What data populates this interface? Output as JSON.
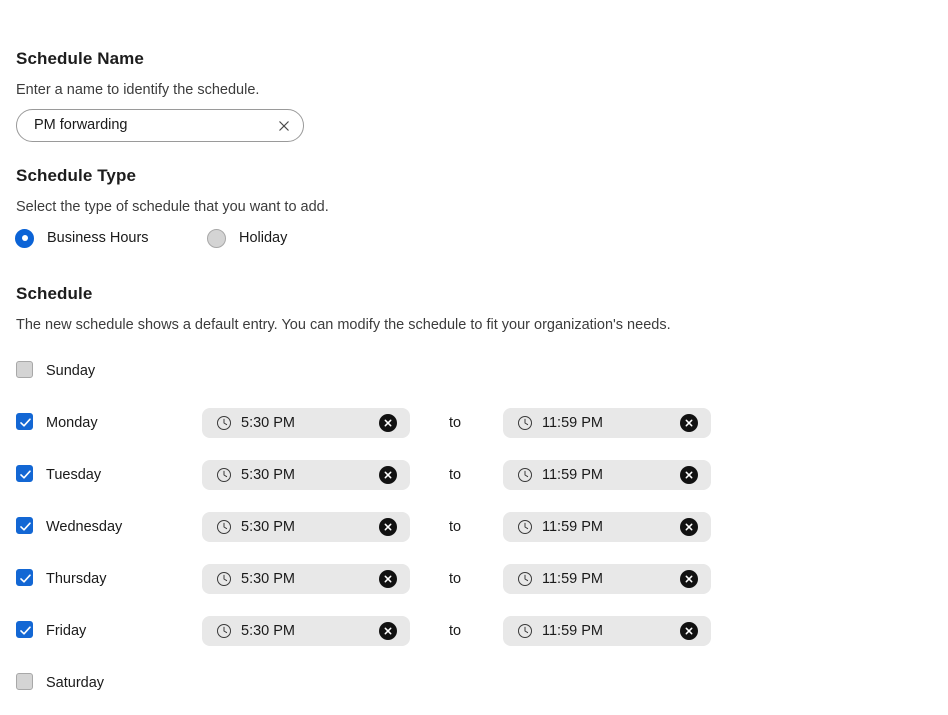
{
  "schedule_name": {
    "title": "Schedule Name",
    "description": "Enter a name to identify the schedule.",
    "value": "PM forwarding",
    "placeholder": "",
    "clear_icon": "close-icon"
  },
  "schedule_type": {
    "title": "Schedule Type",
    "description": "Select the type of schedule that you want to add.",
    "options": [
      {
        "label": "Business Hours",
        "selected": true
      },
      {
        "label": "Holiday",
        "selected": false
      }
    ]
  },
  "schedule": {
    "title": "Schedule",
    "description": "The new schedule shows a default entry. You can modify the schedule to fit your organization's needs.",
    "to_label": "to",
    "clock_icon": "clock-icon",
    "clear_icon": "close-circle-icon",
    "rows": [
      {
        "day": "Sunday",
        "checked": false,
        "has_times": false,
        "start": "",
        "end": ""
      },
      {
        "day": "Monday",
        "checked": true,
        "has_times": true,
        "start": "5:30 PM",
        "end": "11:59 PM"
      },
      {
        "day": "Tuesday",
        "checked": true,
        "has_times": true,
        "start": "5:30 PM",
        "end": "11:59 PM"
      },
      {
        "day": "Wednesday",
        "checked": true,
        "has_times": true,
        "start": "5:30 PM",
        "end": "11:59 PM"
      },
      {
        "day": "Thursday",
        "checked": true,
        "has_times": true,
        "start": "5:30 PM",
        "end": "11:59 PM"
      },
      {
        "day": "Friday",
        "checked": true,
        "has_times": true,
        "start": "5:30 PM",
        "end": "11:59 PM"
      },
      {
        "day": "Saturday",
        "checked": false,
        "has_times": false,
        "start": "",
        "end": ""
      }
    ]
  },
  "colors": {
    "accent": "#0b63d6",
    "checkbox": "#1367d4",
    "pill_bg": "#e8e8e8",
    "clear_button": "#111111",
    "unselected_control": "#d4d4d4"
  }
}
